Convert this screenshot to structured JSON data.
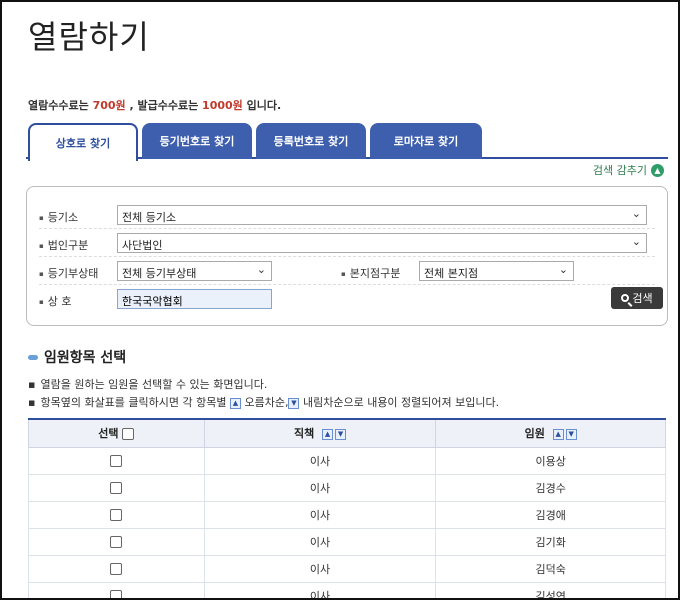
{
  "page": {
    "title": "열람하기"
  },
  "fee": {
    "prefix": "열람수수료는 ",
    "view_fee": "700원",
    "middle": " , 발급수수료는 ",
    "issue_fee": "1000원",
    "suffix": " 입니다."
  },
  "tabs": [
    {
      "label": "상호로 찾기",
      "active": true
    },
    {
      "label": "등기번호로 찾기",
      "active": false
    },
    {
      "label": "등록번호로 찾기",
      "active": false
    },
    {
      "label": "로마자로 찾기",
      "active": false
    }
  ],
  "collapse_label": "검색 감추기",
  "search": {
    "registry_label": "등기소",
    "registry_value": "전체 등기소",
    "corp_type_label": "법인구분",
    "corp_type_value": "사단법인",
    "status_label": "등기부상태",
    "status_value": "전체 등기부상태",
    "branch_label": "본지점구분",
    "branch_value": "전체 본지점",
    "name_label": "상 호",
    "name_value": "한국국악협회",
    "search_button": "검색"
  },
  "section": {
    "title": "임원항목 선택",
    "note1": "열람을 원하는 임원을 선택할 수 있는 화면입니다.",
    "note2_a": "항목옆의 화살표를 클릭하시면 각 항목별 ",
    "note2_b": " 오름차순,",
    "note2_c": " 내림차순으로 내용이 정렬되어져 보입니다."
  },
  "table": {
    "headers": {
      "select": "선택",
      "position": "직책",
      "officer": "임원"
    },
    "rows": [
      {
        "position": "이사",
        "officer": "이용상"
      },
      {
        "position": "이사",
        "officer": "김경수"
      },
      {
        "position": "이사",
        "officer": "김경애"
      },
      {
        "position": "이사",
        "officer": "김기화"
      },
      {
        "position": "이사",
        "officer": "김덕숙"
      },
      {
        "position": "이사",
        "officer": "김성연"
      }
    ]
  },
  "colors": {
    "tab_blue": "#3e5fae",
    "accent_red": "#c0392b",
    "collapse_green": "#2e7d4f"
  }
}
